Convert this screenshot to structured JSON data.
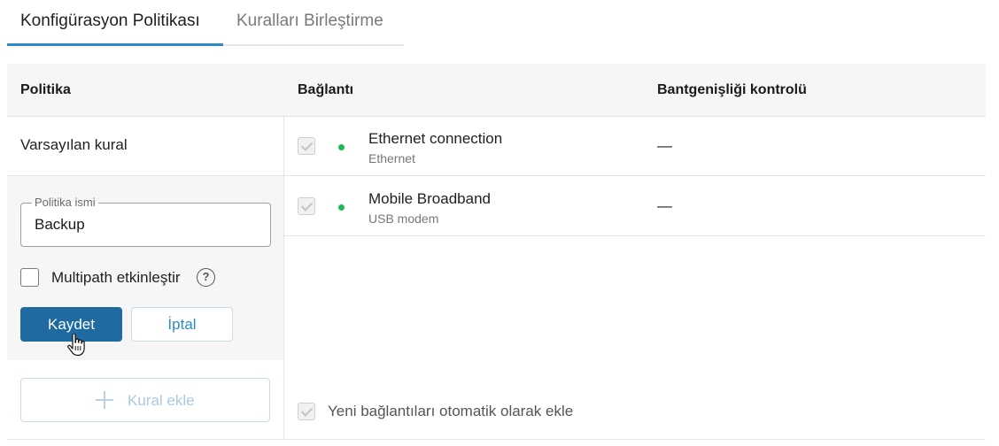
{
  "tabs": [
    {
      "label": "Konfigürasyon Politikası",
      "active": true
    },
    {
      "label": "Kuralları Birleştirme",
      "active": false
    }
  ],
  "table": {
    "headers": {
      "policy": "Politika",
      "connection": "Bağlantı",
      "bandwidth": "Bantgenişliği kontrolü"
    }
  },
  "policies": {
    "default_rule": "Varsayılan kural"
  },
  "edit_form": {
    "name_legend": "Politika ismi",
    "name_value": "Backup",
    "multipath_label": "Multipath etkinleştir",
    "multipath_checked": false,
    "help_glyph": "?",
    "save_label": "Kaydet",
    "cancel_label": "İptal"
  },
  "add_rule_label": "Kural ekle",
  "connections": [
    {
      "name": "Ethernet connection",
      "type": "Ethernet",
      "bandwidth": "—",
      "status_color": "#1db954",
      "checked": true
    },
    {
      "name": "Mobile Broadband",
      "type": "USB modem",
      "bandwidth": "—",
      "status_color": "#1db954",
      "checked": true
    }
  ],
  "auto_add_label": "Yeni bağlantıları otomatik olarak ekle",
  "colors": {
    "accent": "#2a8bc9",
    "primary_button": "#1e6aa1",
    "status_online": "#1db954"
  }
}
